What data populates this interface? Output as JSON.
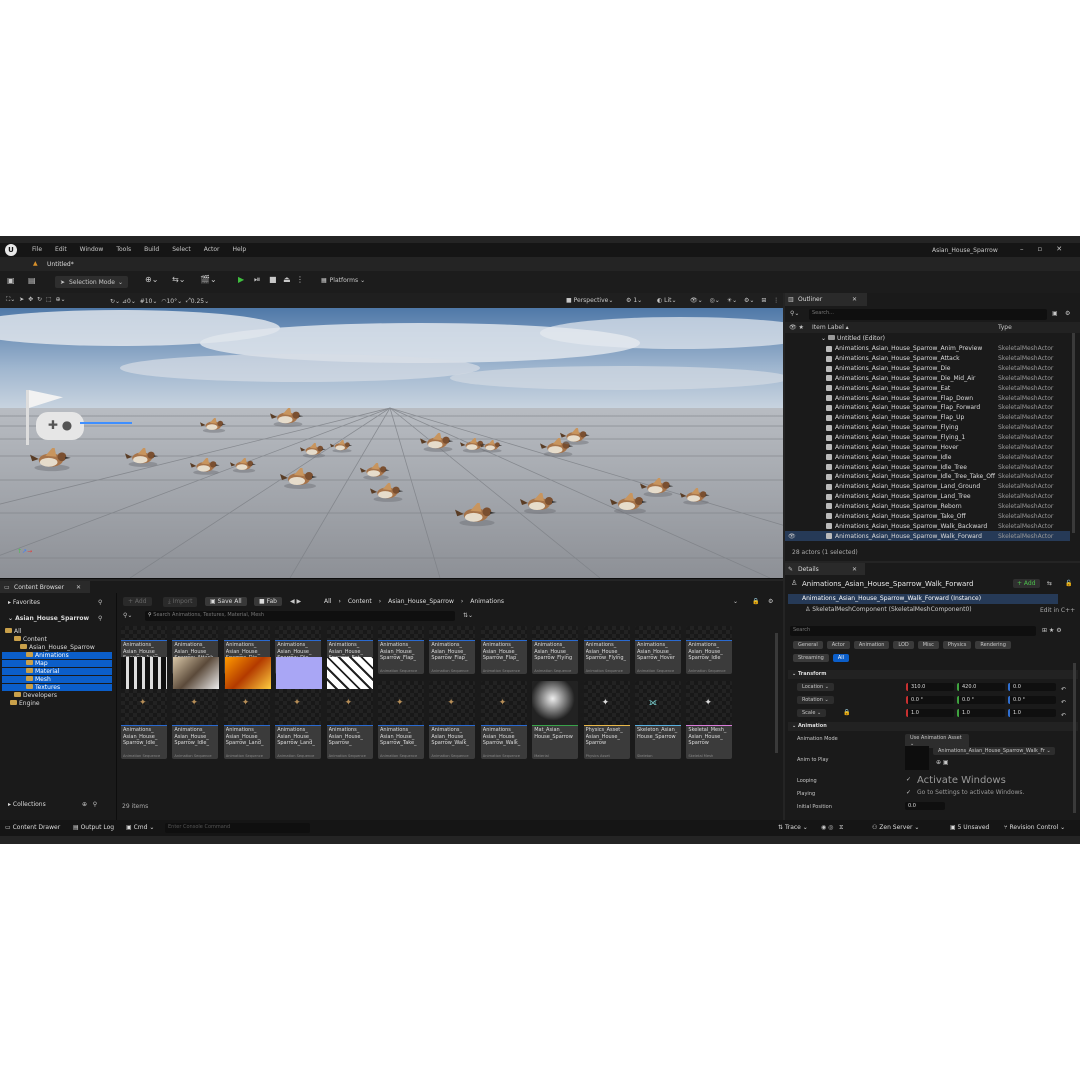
{
  "colors": {
    "accent": "#0b5ec9",
    "green": "#0e9a2b",
    "panel": "#242424"
  },
  "menubar": {
    "logo": "unreal-engine-logo",
    "items": [
      "File",
      "Edit",
      "Window",
      "Tools",
      "Build",
      "Select",
      "Actor",
      "Help"
    ],
    "project_name": "Asian_House_Sparrow",
    "level_tab": "Untitled*"
  },
  "toolbar": {
    "selection_mode": "Selection Mode",
    "platforms": "Platforms"
  },
  "viewport": {
    "grid_snap": "10",
    "rot_snap": "10°",
    "scale_snap": "0.25",
    "angle": "0",
    "perspective": "Perspective",
    "lit": "Lit",
    "camera_speed": "1"
  },
  "outliner": {
    "title": "Outliner",
    "search_placeholder": "Search...",
    "col_label": "Item Label ▴",
    "col_type": "Type",
    "root": "Untitled (Editor)",
    "items": [
      {
        "label": "Animations_Asian_House_Sparrow_Anim_Preview",
        "type": "SkeletalMeshActor"
      },
      {
        "label": "Animations_Asian_House_Sparrow_Attack",
        "type": "SkeletalMeshActor"
      },
      {
        "label": "Animations_Asian_House_Sparrow_Die",
        "type": "SkeletalMeshActor"
      },
      {
        "label": "Animations_Asian_House_Sparrow_Die_Mid_Air",
        "type": "SkeletalMeshActor"
      },
      {
        "label": "Animations_Asian_House_Sparrow_Eat",
        "type": "SkeletalMeshActor"
      },
      {
        "label": "Animations_Asian_House_Sparrow_Flap_Down",
        "type": "SkeletalMeshActor"
      },
      {
        "label": "Animations_Asian_House_Sparrow_Flap_Forward",
        "type": "SkeletalMeshActor"
      },
      {
        "label": "Animations_Asian_House_Sparrow_Flap_Up",
        "type": "SkeletalMeshActor"
      },
      {
        "label": "Animations_Asian_House_Sparrow_Flying",
        "type": "SkeletalMeshActor"
      },
      {
        "label": "Animations_Asian_House_Sparrow_Flying_1",
        "type": "SkeletalMeshActor"
      },
      {
        "label": "Animations_Asian_House_Sparrow_Hover",
        "type": "SkeletalMeshActor"
      },
      {
        "label": "Animations_Asian_House_Sparrow_Idle",
        "type": "SkeletalMeshActor"
      },
      {
        "label": "Animations_Asian_House_Sparrow_Idle_Tree",
        "type": "SkeletalMeshActor"
      },
      {
        "label": "Animations_Asian_House_Sparrow_Idle_Tree_Take_Off",
        "type": "SkeletalMeshActor"
      },
      {
        "label": "Animations_Asian_House_Sparrow_Land_Ground",
        "type": "SkeletalMeshActor"
      },
      {
        "label": "Animations_Asian_House_Sparrow_Land_Tree",
        "type": "SkeletalMeshActor"
      },
      {
        "label": "Animations_Asian_House_Sparrow_Reborn",
        "type": "SkeletalMeshActor"
      },
      {
        "label": "Animations_Asian_House_Sparrow_Take_Off",
        "type": "SkeletalMeshActor"
      },
      {
        "label": "Animations_Asian_House_Sparrow_Walk_Backward",
        "type": "SkeletalMeshActor"
      },
      {
        "label": "Animations_Asian_House_Sparrow_Walk_Forward",
        "type": "SkeletalMeshActor"
      }
    ],
    "footer": "28 actors (1 selected)"
  },
  "details": {
    "title": "Details",
    "actor_name": "Animations_Asian_House_Sparrow_Walk_Forward",
    "add_label": "+ Add",
    "instance": "Animations_Asian_House_Sparrow_Walk_Forward (Instance)",
    "component": "SkeletalMeshComponent (SkeletalMeshComponent0)",
    "edit_cpp": "Edit in C++",
    "search_placeholder": "Search",
    "tabs_row1": [
      "General",
      "Actor",
      "Animation",
      "LOD",
      "Misc",
      "Physics",
      "Rendering"
    ],
    "tabs_row2": [
      "Streaming",
      "All"
    ],
    "transform_header": "Transform",
    "location_label": "Location",
    "rotation_label": "Rotation",
    "scale_label": "Scale",
    "location": [
      "310.0",
      "420.0",
      "0.0"
    ],
    "rotation": [
      "0.0 °",
      "0.0 °",
      "0.0 °"
    ],
    "scale": [
      "1.0",
      "1.0",
      "1.0"
    ],
    "animation_header": "Animation",
    "anim_mode_label": "Animation Mode",
    "anim_mode": "Use Animation Asset",
    "anim_to_play_label": "Anim to Play",
    "anim_to_play": "Animations_Asian_House_Sparrow_Walk_Fr",
    "looping_label": "Looping",
    "playing_label": "Playing",
    "initial_position_label": "Initial Position",
    "initial_position": "0.0",
    "watermark_title": "Activate Windows",
    "watermark_sub": "Go to Settings to activate Windows."
  },
  "content_browser": {
    "title": "Content Browser",
    "add": "+ Add",
    "import": "Import",
    "save_all": "Save All",
    "fab": "Fab",
    "breadcrumb": [
      "All",
      "Content",
      "Asian_House_Sparrow",
      "Animations"
    ],
    "search_placeholder": "Search Animations, Textures, Material, Mesh",
    "favorites": "Favorites",
    "project": "Asian_House_Sparrow",
    "collections": "Collections",
    "count": "29 items",
    "tree": [
      "All",
      "Content",
      "Asian_House_Sparrow",
      "Animations",
      "Map",
      "Material",
      "Mesh",
      "Textures",
      "Developers",
      "Engine"
    ],
    "row1": [
      {
        "name": "Animations_\nAsian_House_\nSparrow_Anim_",
        "type": "Animation Sequence"
      },
      {
        "name": "Animations_\nAsian_House_\nSparrow_Attack",
        "type": "Animation Sequence"
      },
      {
        "name": "Animations_\nAsian_House_\nSparrow_Die",
        "type": "Animation Sequence"
      },
      {
        "name": "Animations_\nAsian_House_\nSparrow_Die_",
        "type": "Animation Sequence"
      },
      {
        "name": "Animations_\nAsian_House_\nSparrow_Eat",
        "type": "Animation Sequence"
      },
      {
        "name": "Animations_\nAsian_House_\nSparrow_Flap_",
        "type": "Animation Sequence"
      },
      {
        "name": "Animations_\nAsian_House_\nSparrow_Flap_",
        "type": "Animation Sequence"
      },
      {
        "name": "Animations_\nAsian_House_\nSparrow_Flap_",
        "type": "Animation Sequence"
      },
      {
        "name": "Animations_\nAsian_House_\nSparrow_Flying",
        "type": "Animation Sequence"
      },
      {
        "name": "Animations_\nAsian_House_\nSparrow_Flying_",
        "type": "Animation Sequence"
      },
      {
        "name": "Animations_\nAsian_House_\nSparrow_Hover",
        "type": "Animation Sequence"
      },
      {
        "name": "Animations_\nAsian_House_\nSparrow_Idle",
        "type": "Animation Sequence"
      }
    ],
    "row2": [
      {
        "name": "Animations_\nAsian_House_\nSparrow_Idle_",
        "type": "Animation Sequence"
      },
      {
        "name": "Animations_\nAsian_House_\nSparrow_Idle_",
        "type": "Animation Sequence"
      },
      {
        "name": "Animations_\nAsian_House_\nSparrow_Land_",
        "type": "Animation Sequence"
      },
      {
        "name": "Animations_\nAsian_House_\nSparrow_Land_",
        "type": "Animation Sequence"
      },
      {
        "name": "Animations_\nAsian_House_\nSparrow_",
        "type": "Animation Sequence"
      },
      {
        "name": "Animations_\nAsian_House_\nSparrow_Take_",
        "type": "Animation Sequence"
      },
      {
        "name": "Animations_\nAsian_House_\nSparrow_Walk_",
        "type": "Animation Sequence"
      },
      {
        "name": "Animations_\nAsian_House_\nSparrow_Walk_",
        "type": "Animation Sequence"
      },
      {
        "name": "Mat_Asian_\nHouse_Sparrow",
        "type": "Material"
      },
      {
        "name": "Physics_Asset_\nAsian_House_\nSparrow",
        "type": "Physics Asset"
      },
      {
        "name": "Skeleton_Asian_\nHouse_Sparrow",
        "type": "Skeleton"
      },
      {
        "name": "Skeletal_Mesh_\nAsian_House_\nSparrow",
        "type": "Skeletal Mesh"
      }
    ]
  },
  "statusbar": {
    "content_drawer": "Content Drawer",
    "output_log": "Output Log",
    "cmd": "Cmd",
    "console_placeholder": "Enter Console Command",
    "trace": "Trace",
    "zen_server": "Zen Server",
    "unsaved": "5 Unsaved",
    "revision_control": "Revision Control"
  }
}
